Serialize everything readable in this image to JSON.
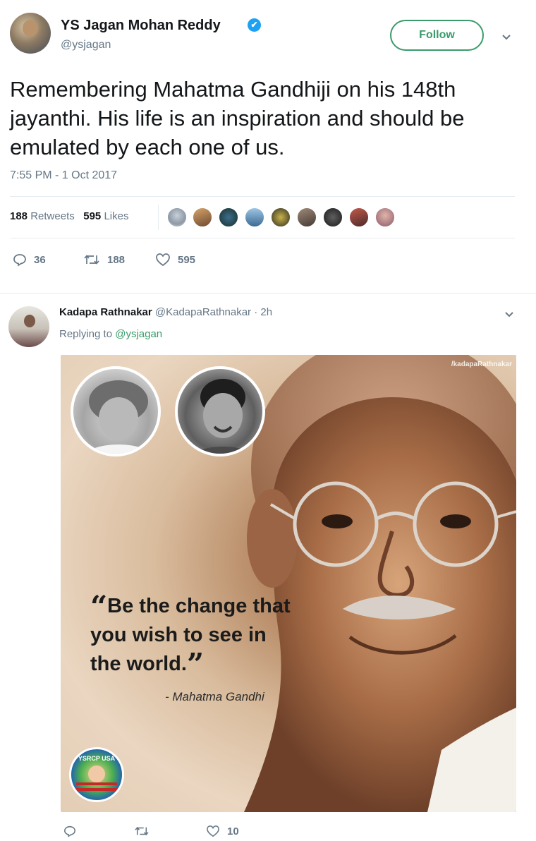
{
  "main_tweet": {
    "author_name": "YS Jagan Mohan Reddy",
    "verified_mark": "✔",
    "handle": "@ysjagan",
    "follow_label": "Follow",
    "text": "Remembering Mahatma Gandhiji on his 148th jayanthi. His life is an inspiration and should be emulated by each one of us.",
    "timestamp": "7:55 PM - 1 Oct 2017",
    "stats": {
      "retweets_count": "188",
      "retweets_label": "Retweets",
      "likes_count": "595",
      "likes_label": "Likes"
    },
    "actions": {
      "reply_count": "36",
      "retweet_count": "188",
      "like_count": "595"
    },
    "icons": {
      "verified": "verified-badge-icon",
      "caret": "chevron-down-icon",
      "reply": "reply-icon",
      "retweet": "retweet-icon",
      "like": "heart-icon"
    }
  },
  "reply_tweet": {
    "author_name": "Kadapa Rathnakar",
    "handle": "@KadapaRathnakar",
    "separator": "·",
    "time": "2h",
    "replying_prefix": "Replying to",
    "replying_to": "@ysjagan",
    "image": {
      "watermark": "/kadapaRathnakar",
      "quote_open": "“",
      "quote_line1": "Be the change that",
      "quote_line2": "you wish to see in",
      "quote_line3": "the world.",
      "quote_close": "”",
      "attribution": "- Mahatma Gandhi",
      "badge_text": "YSRCP USA"
    },
    "actions": {
      "reply_count": "",
      "retweet_count": "",
      "like_count": "10"
    }
  },
  "colors": {
    "accent_green": "#3a9b6b",
    "verified_blue": "#1da1f2",
    "muted_text": "#657786",
    "divider": "#e6ecf0"
  }
}
